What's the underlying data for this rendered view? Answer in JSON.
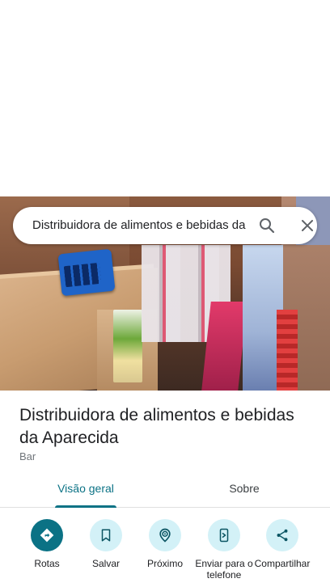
{
  "search": {
    "query": "Distribuidora de alimentos e bebidas da Aparecida"
  },
  "place": {
    "name": "Distribuidora de alimentos e bebidas da Aparecida",
    "category": "Bar"
  },
  "tabs": [
    {
      "label": "Visão geral",
      "active": true
    },
    {
      "label": "Sobre",
      "active": false
    }
  ],
  "actions": [
    {
      "label": "Rotas",
      "icon": "directions-icon"
    },
    {
      "label": "Salvar",
      "icon": "bookmark-icon"
    },
    {
      "label": "Próximo",
      "icon": "nearby-icon"
    },
    {
      "label": "Enviar para o telefone",
      "icon": "send-to-phone-icon"
    },
    {
      "label": "Compartilhar",
      "icon": "share-icon"
    }
  ],
  "colors": {
    "accent": "#0b7285",
    "action_bg": "#d3f1f7",
    "text": "#202124",
    "secondary_text": "#70757a"
  }
}
